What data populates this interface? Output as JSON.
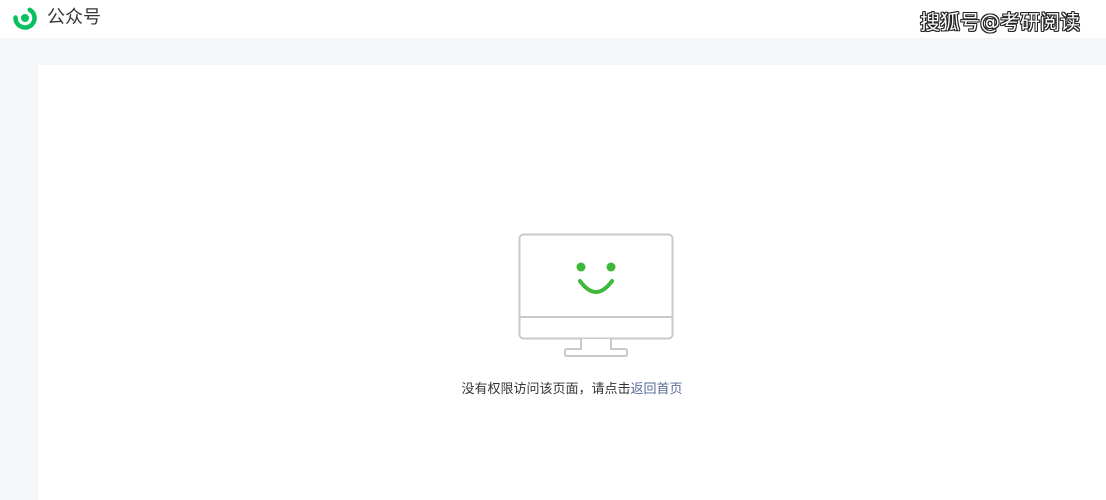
{
  "header": {
    "brand_label": "公众号",
    "logo_icon": "wechat-official-account-logo-icon",
    "brand_color": "#07c160"
  },
  "watermark": {
    "text": "搜狐号@考研阅读"
  },
  "error": {
    "illustration_icon": "monitor-smiley-icon",
    "message_prefix": "没有权限访问该页面，请点击",
    "home_link_label": "返回首页",
    "accent_color": "#3db838",
    "link_color": "#576b95"
  }
}
